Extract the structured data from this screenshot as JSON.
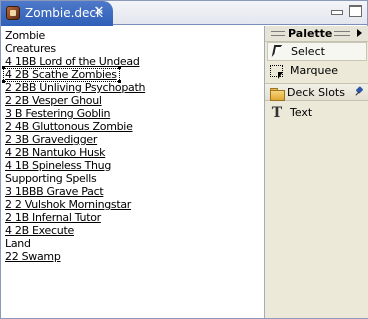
{
  "tab": {
    "title": "Zombie.deck",
    "close_glyph": "✕",
    "icon": "deck-file-icon"
  },
  "window_controls": {
    "minimize_icon": "minimize-icon",
    "maximize_icon": "maximize-icon"
  },
  "editor": {
    "lines": [
      {
        "text": "Zombie",
        "kind": "heading"
      },
      {
        "text": "Creatures",
        "kind": "heading"
      },
      {
        "text": "4 1BB Lord of the Undead",
        "kind": "card"
      },
      {
        "text": "4 2B Scathe Zombies",
        "kind": "card",
        "selected": true
      },
      {
        "text": "2 2BB Unliving Psychopath",
        "kind": "card"
      },
      {
        "text": "2 2B Vesper Ghoul",
        "kind": "card"
      },
      {
        "text": "3 B Festering Goblin",
        "kind": "card"
      },
      {
        "text": "2 4B Gluttonous Zombie",
        "kind": "card"
      },
      {
        "text": "2 3B Gravedigger",
        "kind": "card"
      },
      {
        "text": "4 2B Nantuko Husk",
        "kind": "card"
      },
      {
        "text": "4 1B Spineless Thug",
        "kind": "card"
      },
      {
        "text": "Supporting Spells",
        "kind": "heading"
      },
      {
        "text": "3 1BBB Grave Pact",
        "kind": "card"
      },
      {
        "text": "2 2 Vulshok Morningstar",
        "kind": "card"
      },
      {
        "text": "2 1B Infernal Tutor",
        "kind": "card"
      },
      {
        "text": "4 2B Execute",
        "kind": "card"
      },
      {
        "text": "Land",
        "kind": "heading"
      },
      {
        "text": "22 Swamp",
        "kind": "card"
      }
    ]
  },
  "palette": {
    "title": "Palette",
    "tools": {
      "select": "Select",
      "marquee": "Marquee"
    },
    "drawer": {
      "label": "Deck Slots"
    },
    "text_tool": "Text",
    "text_tool_glyph": "T"
  },
  "colors": {
    "tab_active": "#3a67bf",
    "palette_bg": "#ece9d8",
    "editor_bg": "#ffffff",
    "border": "#8c99b8"
  }
}
